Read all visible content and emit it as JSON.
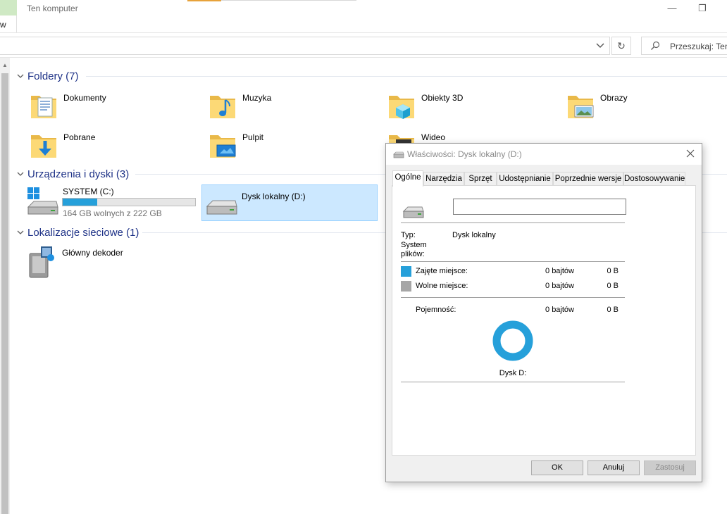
{
  "window": {
    "title": "Ten komputer",
    "ribbon_tab_fragment": "w",
    "minimize_label": "—",
    "restore_label": "❐"
  },
  "address_bar": {
    "refresh_label": "↻",
    "search_placeholder": "Przeszukaj: Ten"
  },
  "sections": {
    "folders": {
      "title": "Foldery (7)",
      "items": [
        {
          "name": "Dokumenty",
          "icon": "documents-folder-icon"
        },
        {
          "name": "Muzyka",
          "icon": "music-folder-icon"
        },
        {
          "name": "Obiekty 3D",
          "icon": "3d-objects-folder-icon"
        },
        {
          "name": "Obrazy",
          "icon": "pictures-folder-icon"
        },
        {
          "name": "Pobrane",
          "icon": "downloads-folder-icon"
        },
        {
          "name": "Pulpit",
          "icon": "desktop-folder-icon"
        },
        {
          "name": "Wideo",
          "icon": "videos-folder-icon"
        }
      ]
    },
    "devices": {
      "title": "Urządzenia i dyski (3)",
      "drives": [
        {
          "name": "SYSTEM (C:)",
          "free_text": "164 GB wolnych z 222 GB",
          "used_fraction": 0.26
        },
        {
          "name": "Dysk lokalny (D:)"
        }
      ]
    },
    "network": {
      "title": "Lokalizacje sieciowe (1)",
      "items": [
        {
          "name": "Główny dekoder"
        }
      ]
    }
  },
  "dialog": {
    "title": "Właściwości: Dysk lokalny (D:)",
    "tabs": [
      "Ogólne",
      "Narzędzia",
      "Sprzęt",
      "Udostępnianie",
      "Poprzednie wersje",
      "Dostosowywanie"
    ],
    "active_tab": "Ogólne",
    "name_field_value": "",
    "type_label": "Typ:",
    "type_value": "Dysk lokalny",
    "fs_label_line1": "System",
    "fs_label_line2": "plików:",
    "used_label": "Zajęte miejsce:",
    "used_bytes": "0 bajtów",
    "used_size": "0 B",
    "free_label": "Wolne miejsce:",
    "free_bytes": "0 bajtów",
    "free_size": "0 B",
    "capacity_label": "Pojemność:",
    "capacity_bytes": "0 bajtów",
    "capacity_size": "0 B",
    "disk_label": "Dysk D:",
    "buttons": {
      "ok": "OK",
      "cancel": "Anuluj",
      "apply": "Zastosuj"
    },
    "colors": {
      "used": "#26a0da",
      "free": "#a6a6a6"
    }
  }
}
